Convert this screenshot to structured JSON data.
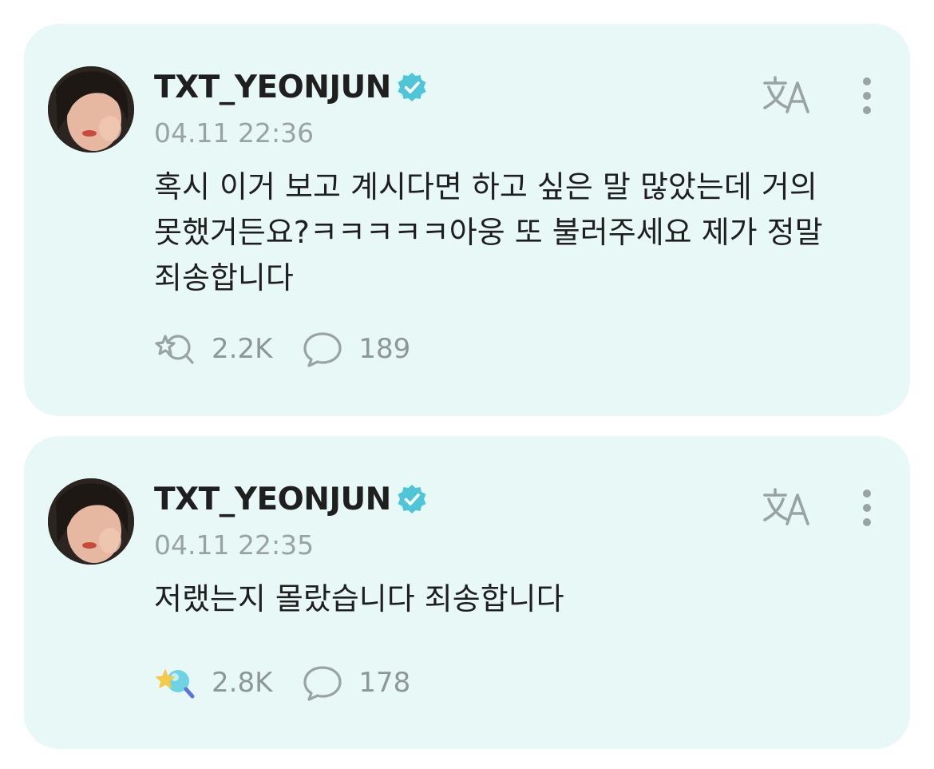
{
  "posts": [
    {
      "author": "TXT_YEONJUN",
      "timestamp": "04.11 22:36",
      "body": "혹시 이거 보고 계시다면 하고 싶은 말 많았는데 거의 못했거든요?ㅋㅋㅋㅋㅋ아웅 또 불러주세요 제가 정말 죄송합니다",
      "likes": "2.2K",
      "comments": "189",
      "liked": false
    },
    {
      "author": "TXT_YEONJUN",
      "timestamp": "04.11 22:35",
      "body": "저랬는지 몰랐습니다 죄송합니다",
      "likes": "2.8K",
      "comments": "178",
      "liked": true
    }
  ],
  "icons": {
    "verified": "verified-badge-icon",
    "translate": "translate-icon",
    "more": "more-vertical-icon",
    "like": "star-bubble-like-icon",
    "comment": "comment-bubble-icon"
  },
  "colors": {
    "card_background": "#e7f8f6",
    "verified": "#4fc6d8",
    "muted": "#9aa3a3",
    "text": "#1f1f1f"
  }
}
